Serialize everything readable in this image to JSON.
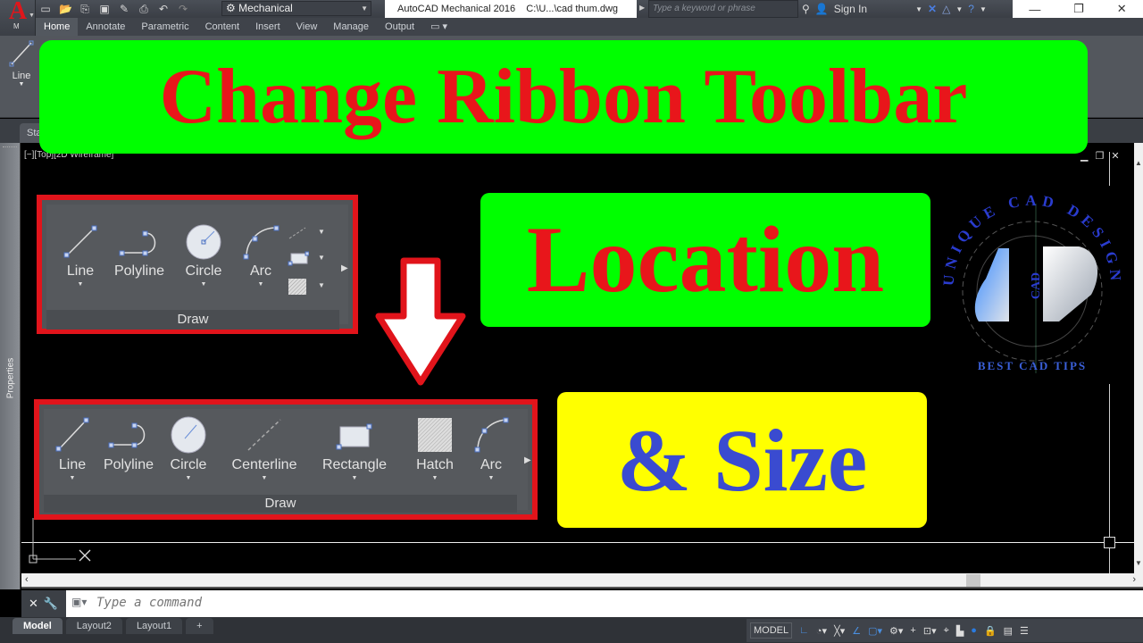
{
  "app": {
    "title": "AutoCAD Mechanical 2016    C:\\U...\\cad thum.dwg",
    "menu_letter": "M",
    "workspace": "Mechanical",
    "search_placeholder": "Type a keyword or phrase",
    "sign_in": "Sign In",
    "window_controls": {
      "minimize": "—",
      "restore": "❐",
      "close": "✕"
    }
  },
  "quick_access": [
    "new-icon",
    "open-icon",
    "save-cloud-icon",
    "save-icon",
    "save-as-icon",
    "print-icon",
    "undo-icon",
    "redo-icon"
  ],
  "ribbon": {
    "tabs": [
      "Home",
      "Annotate",
      "Parametric",
      "Content",
      "Insert",
      "View",
      "Manage",
      "Output"
    ],
    "active_tab": "Home",
    "visible_tool": "Line"
  },
  "file_tab": "Sta",
  "viewport": {
    "label": "[−][Top][2D Wireframe]",
    "controls": {
      "minimize": "▁",
      "restore": "❐",
      "close": "✕"
    }
  },
  "side_palette": "Properties",
  "banners": {
    "title": "Change Ribbon Toolbar",
    "location": "Location",
    "size": "& Size"
  },
  "draw_panel_before": {
    "title": "Draw",
    "tools": [
      {
        "label": "Line",
        "has_dropdown": true
      },
      {
        "label": "Polyline",
        "has_dropdown": false
      },
      {
        "label": "Circle",
        "has_dropdown": true
      },
      {
        "label": "Arc",
        "has_dropdown": true
      }
    ],
    "small_tools": [
      "centerline-icon",
      "rectangle-icon",
      "hatch-icon"
    ]
  },
  "draw_panel_after": {
    "title": "Draw",
    "tools": [
      {
        "label": "Line",
        "has_dropdown": true
      },
      {
        "label": "Polyline",
        "has_dropdown": false
      },
      {
        "label": "Circle",
        "has_dropdown": true
      },
      {
        "label": "Centerline",
        "has_dropdown": true
      },
      {
        "label": "Rectangle",
        "has_dropdown": true
      },
      {
        "label": "Hatch",
        "has_dropdown": true
      },
      {
        "label": "Arc",
        "has_dropdown": true
      }
    ]
  },
  "logo": {
    "arc_text": "UNIQUE CAD DESIGN",
    "center_text": "CAD",
    "bottom_text": "BEST CAD TIPS"
  },
  "command_line": {
    "placeholder": "Type a command"
  },
  "layout_tabs": [
    {
      "label": "Model",
      "active": true
    },
    {
      "label": "Layout2",
      "active": false
    },
    {
      "label": "Layout1",
      "active": false
    },
    {
      "label": "+",
      "active": false
    }
  ],
  "status_bar": {
    "model_label": "MODEL"
  },
  "colors": {
    "banner_green": "#00ff00",
    "banner_yellow": "#ffff00",
    "banner_red_text": "#e8161b",
    "banner_blue_text": "#3a4bd0",
    "highlight_border": "#e1141b"
  }
}
